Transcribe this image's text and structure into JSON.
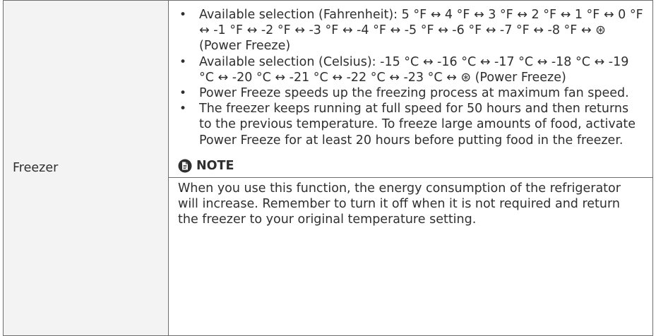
{
  "row": {
    "label": "Freezer"
  },
  "bullets": [
    "Available selection (Fahrenheit): 5 °F ↔ 4 °F ↔ 3 °F ↔ 2 °F ↔ 1 °F ↔ 0 °F ↔ -1 °F ↔ -2 °F ↔ -3 °F ↔ -4 °F ↔ -5 °F ↔ -6 °F ↔ -7 °F ↔ -8 °F ↔ ⊛ (Power Freeze)",
    "Available selection (Celsius): -15 °C ↔ -16 °C ↔ -17 °C ↔ -18 °C ↔ -19 °C ↔ -20 °C ↔ -21 °C ↔ -22 °C ↔ -23 °C ↔ ⊛ (Power Freeze)",
    "Power Freeze speeds up the freezing process at maximum fan speed.",
    "The freezer keeps running at full speed for 50 hours and then returns to the previous temperature. To freeze large amounts of food, activate Power Freeze for at least 20 hours before putting food in the freezer."
  ],
  "bullet_marker": "•",
  "note": {
    "icon": "note-icon",
    "heading": "NOTE",
    "text": "When you use this function, the energy consumption of the refrigerator will increase. Remember to turn it off when it is not required and return the freezer to your original temperature setting."
  }
}
